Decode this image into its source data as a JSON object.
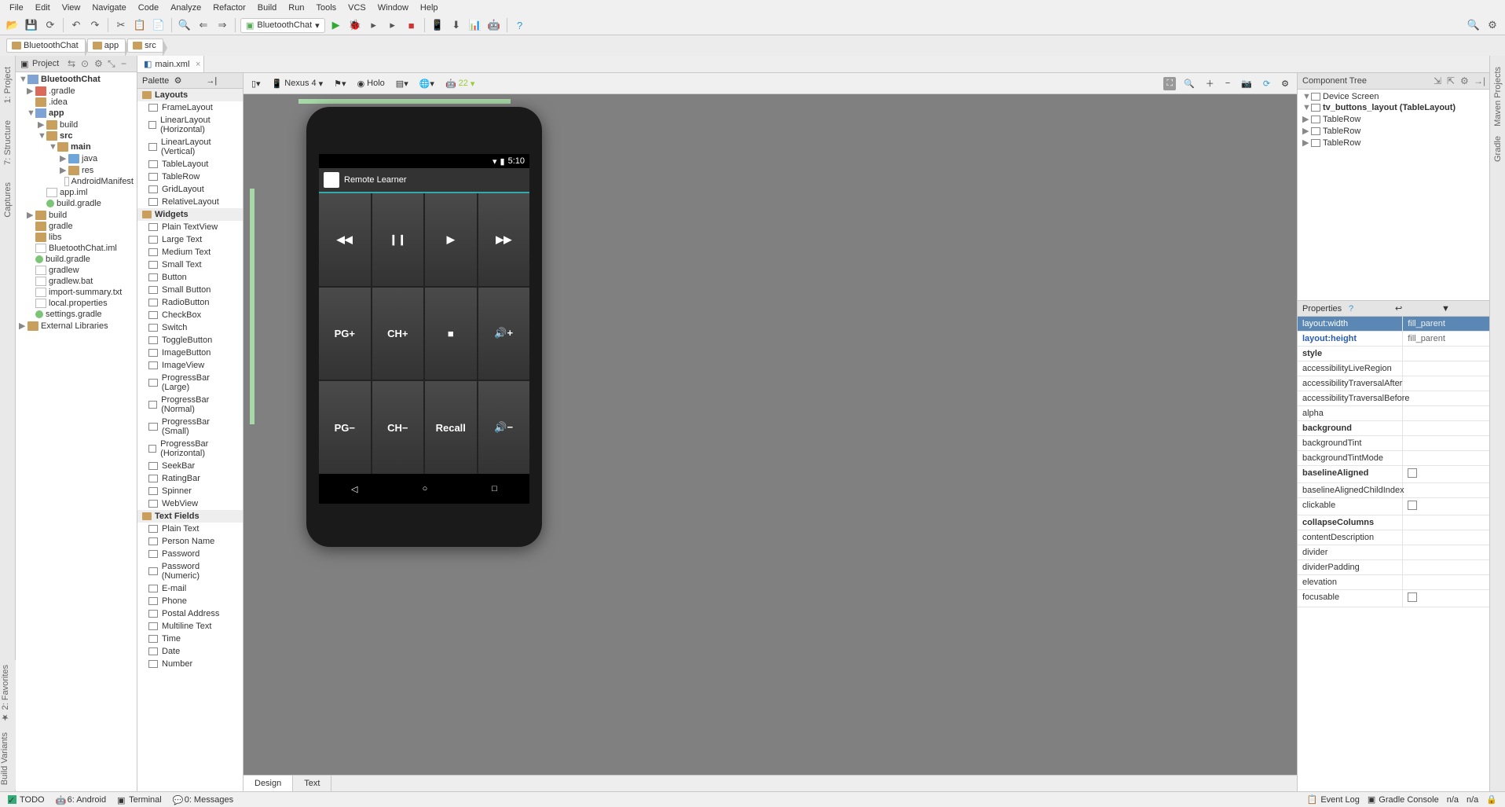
{
  "menu": [
    "File",
    "Edit",
    "View",
    "Navigate",
    "Code",
    "Analyze",
    "Refactor",
    "Build",
    "Run",
    "Tools",
    "VCS",
    "Window",
    "Help"
  ],
  "toolbar": {
    "run_config": "BluetoothChat"
  },
  "breadcrumb": [
    "BluetoothChat",
    "app",
    "src"
  ],
  "sidetabs_left": [
    "1: Project",
    "7: Structure",
    "Captures"
  ],
  "sidetabs_left_bottom": [
    "★ 2: Favorites",
    "Build Variants"
  ],
  "sidetabs_right": [
    "Maven Projects",
    "Gradle"
  ],
  "project": {
    "title": "Project",
    "tree": [
      {
        "ind": 0,
        "tw": "▼",
        "ic": "mod",
        "txt": "BluetoothChat",
        "bold": true
      },
      {
        "ind": 1,
        "tw": "▶",
        "ic": "folder red",
        "txt": ".gradle"
      },
      {
        "ind": 1,
        "tw": "",
        "ic": "folder",
        "txt": ".idea"
      },
      {
        "ind": 1,
        "tw": "▼",
        "ic": "mod",
        "txt": "app",
        "bold": true
      },
      {
        "ind": 2,
        "tw": "▶",
        "ic": "folder",
        "txt": "build"
      },
      {
        "ind": 2,
        "tw": "▼",
        "ic": "folder",
        "txt": "src",
        "bold": true
      },
      {
        "ind": 3,
        "tw": "▼",
        "ic": "folder",
        "txt": "main",
        "bold": true
      },
      {
        "ind": 4,
        "tw": "▶",
        "ic": "folder blue",
        "txt": "java"
      },
      {
        "ind": 4,
        "tw": "▶",
        "ic": "folder",
        "txt": "res"
      },
      {
        "ind": 4,
        "tw": "",
        "ic": "file",
        "txt": "AndroidManifest"
      },
      {
        "ind": 2,
        "tw": "",
        "ic": "file",
        "txt": "app.iml"
      },
      {
        "ind": 2,
        "tw": "",
        "ic": "gradle",
        "txt": "build.gradle"
      },
      {
        "ind": 1,
        "tw": "▶",
        "ic": "folder",
        "txt": "build"
      },
      {
        "ind": 1,
        "tw": "",
        "ic": "folder",
        "txt": "gradle"
      },
      {
        "ind": 1,
        "tw": "",
        "ic": "folder",
        "txt": "libs"
      },
      {
        "ind": 1,
        "tw": "",
        "ic": "file",
        "txt": "BluetoothChat.iml"
      },
      {
        "ind": 1,
        "tw": "",
        "ic": "gradle",
        "txt": "build.gradle"
      },
      {
        "ind": 1,
        "tw": "",
        "ic": "file",
        "txt": "gradlew"
      },
      {
        "ind": 1,
        "tw": "",
        "ic": "file",
        "txt": "gradlew.bat"
      },
      {
        "ind": 1,
        "tw": "",
        "ic": "file",
        "txt": "import-summary.txt"
      },
      {
        "ind": 1,
        "tw": "",
        "ic": "file",
        "txt": "local.properties"
      },
      {
        "ind": 1,
        "tw": "",
        "ic": "gradle",
        "txt": "settings.gradle"
      },
      {
        "ind": 0,
        "tw": "▶",
        "ic": "folder",
        "txt": "External Libraries"
      }
    ]
  },
  "editor_tab": "main.xml",
  "palette": {
    "title": "Palette",
    "groups": [
      {
        "name": "Layouts",
        "items": [
          "FrameLayout",
          "LinearLayout (Horizontal)",
          "LinearLayout (Vertical)",
          "TableLayout",
          "TableRow",
          "GridLayout",
          "RelativeLayout"
        ]
      },
      {
        "name": "Widgets",
        "items": [
          "Plain TextView",
          "Large Text",
          "Medium Text",
          "Small Text",
          "Button",
          "Small Button",
          "RadioButton",
          "CheckBox",
          "Switch",
          "ToggleButton",
          "ImageButton",
          "ImageView",
          "ProgressBar (Large)",
          "ProgressBar (Normal)",
          "ProgressBar (Small)",
          "ProgressBar (Horizontal)",
          "SeekBar",
          "RatingBar",
          "Spinner",
          "WebView"
        ]
      },
      {
        "name": "Text Fields",
        "items": [
          "Plain Text",
          "Person Name",
          "Password",
          "Password (Numeric)",
          "E-mail",
          "Phone",
          "Postal Address",
          "Multiline Text",
          "Time",
          "Date",
          "Number"
        ]
      }
    ]
  },
  "canvas_toolbar": {
    "device": "Nexus 4",
    "theme": "Holo",
    "api": "22"
  },
  "design_tabs": [
    "Design",
    "Text"
  ],
  "phone": {
    "time": "5:10",
    "app_title": "Remote Learner",
    "buttons": [
      "◀◀",
      "❙❙",
      "▶",
      "▶▶",
      "PG+",
      "CH+",
      "■",
      "🔊+",
      "PG−",
      "CH−",
      "Recall",
      "🔊−"
    ]
  },
  "component_tree": {
    "title": "Component Tree",
    "items": [
      {
        "ind": 0,
        "tw": "▼",
        "txt": "Device Screen"
      },
      {
        "ind": 1,
        "tw": "▼",
        "txt": "tv_buttons_layout (TableLayout)",
        "bold": true
      },
      {
        "ind": 2,
        "tw": "▶",
        "txt": "TableRow"
      },
      {
        "ind": 2,
        "tw": "▶",
        "txt": "TableRow"
      },
      {
        "ind": 2,
        "tw": "▶",
        "txt": "TableRow"
      }
    ]
  },
  "properties": {
    "title": "Properties",
    "rows": [
      {
        "k": "layout:width",
        "v": "fill_parent",
        "sel": true
      },
      {
        "k": "layout:height",
        "v": "fill_parent",
        "blue": true
      },
      {
        "k": "style",
        "v": "",
        "bold": true
      },
      {
        "k": "accessibilityLiveRegion",
        "v": ""
      },
      {
        "k": "accessibilityTraversalAfter",
        "v": ""
      },
      {
        "k": "accessibilityTraversalBefore",
        "v": ""
      },
      {
        "k": "alpha",
        "v": ""
      },
      {
        "k": "background",
        "v": "",
        "bold": true
      },
      {
        "k": "backgroundTint",
        "v": ""
      },
      {
        "k": "backgroundTintMode",
        "v": ""
      },
      {
        "k": "baselineAligned",
        "v": "",
        "bold": true,
        "cb": true
      },
      {
        "k": "baselineAlignedChildIndex",
        "v": ""
      },
      {
        "k": "clickable",
        "v": "",
        "cb": true
      },
      {
        "k": "collapseColumns",
        "v": "",
        "bold": true
      },
      {
        "k": "contentDescription",
        "v": ""
      },
      {
        "k": "divider",
        "v": ""
      },
      {
        "k": "dividerPadding",
        "v": ""
      },
      {
        "k": "elevation",
        "v": ""
      },
      {
        "k": "focusable",
        "v": "",
        "cb": true
      }
    ]
  },
  "statusbar": {
    "items": [
      "TODO",
      "6: Android",
      "Terminal",
      "0: Messages"
    ],
    "right": [
      "Event Log",
      "Gradle Console",
      "n/a",
      "n/a"
    ]
  }
}
